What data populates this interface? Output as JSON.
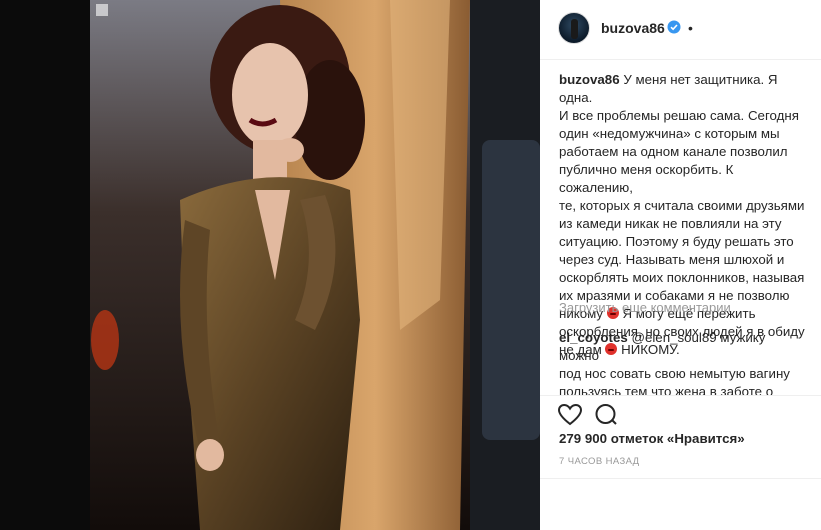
{
  "post": {
    "username": "buzova86",
    "caption_username": "buzova86",
    "caption_text": "У меня нет защитника. Я одна.\nИ все проблемы решаю сама. Сегодня\nодин «недомужчина» с которым мы\nработаем на одном канале позволил\nпублично меня оскорбить. К сожалению,\nте, которых я считала своими друзьями\nиз камеди никак не повлияли на эту\nситуацию. Поэтому я буду решать это\nчерез суд. Называть меня шлюхой и\nоскорблять моих поклонников, называя\nих мразями и собаками я не позволю",
    "caption_line_12a": "никому",
    "caption_line_12b": " Я могу ещё пережить",
    "caption_line_13": "оскорбления, но своих людей я в обиду",
    "caption_line_14a": "не дам",
    "caption_line_14b": " НИКОМУ.",
    "load_more": "Загрузить еще комментарии",
    "comment_username": "el_coyotes",
    "comment_mention": "@elen_soul89",
    "comment_text": " мужику можно\nпод нос совать свою немытую вагину\nпользуясь тем что жена в заботе о\nмаленьком ребенке. Благо",
    "likes": "279 900 отметок «Нравится»",
    "time_ago": "7 ЧАСОВ НАЗАД"
  },
  "icons": {
    "like": "heart-icon",
    "comment": "comment-icon",
    "verified": "verified-badge-icon"
  },
  "colors": {
    "verified": "#3897f0",
    "text": "#262626",
    "muted": "#999999",
    "link": "#003569"
  }
}
